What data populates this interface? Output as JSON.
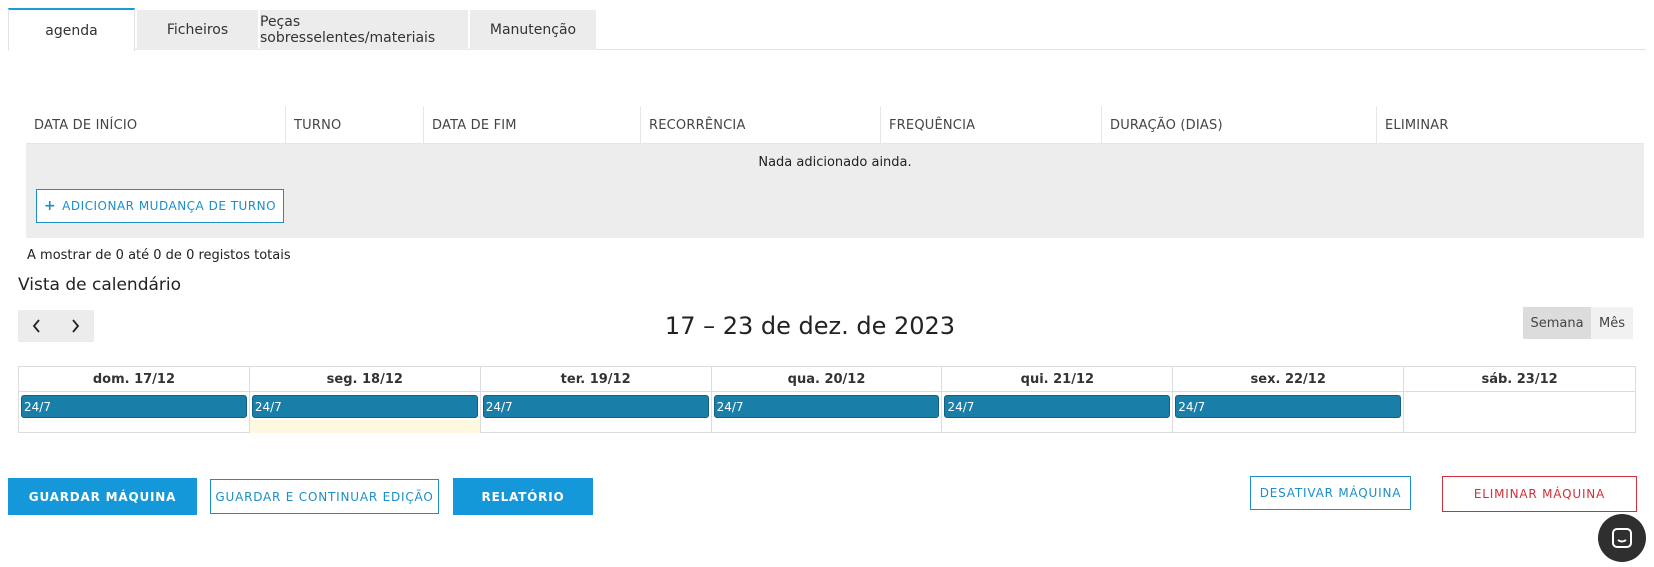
{
  "tabs": [
    {
      "label": "agenda",
      "active": true
    },
    {
      "label": "Ficheiros",
      "active": false
    },
    {
      "label": "Peças sobresselentes/materiais",
      "active": false
    },
    {
      "label": "Manutenção",
      "active": false
    }
  ],
  "table": {
    "columns": [
      "DATA DE INÍCIO",
      "TURNO",
      "DATA DE FIM",
      "RECORRÊNCIA",
      "FREQUÊNCIA",
      "DURAÇÃO (DIAS)",
      "ELIMINAR"
    ],
    "empty_text": "Nada adicionado ainda.",
    "add_button_label": "ADICIONAR MUDANÇA DE TURNO",
    "records_text": "A mostrar de 0 até 0 de 0 registos totais"
  },
  "calendar": {
    "title": "Vista de calendário",
    "range": "17 – 23 de dez. de 2023",
    "views": [
      "Semana",
      "Mês"
    ],
    "active_view": "Semana",
    "days": [
      {
        "label": "dom. 17/12",
        "event": "24/7"
      },
      {
        "label": "seg. 18/12",
        "event": "24/7"
      },
      {
        "label": "ter. 19/12",
        "event": "24/7"
      },
      {
        "label": "qua. 20/12",
        "event": "24/7"
      },
      {
        "label": "qui. 21/12",
        "event": "24/7"
      },
      {
        "label": "sex. 22/12",
        "event": "24/7"
      },
      {
        "label": "sáb. 23/12",
        "event": null
      }
    ]
  },
  "actions": {
    "save": "GUARDAR MÁQUINA",
    "save_continue": "GUARDAR E CONTINUAR EDIÇÃO",
    "report": "RELATÓRIO",
    "disable": "DESATIVAR MÁQUINA",
    "delete": "ELIMINAR MÁQUINA"
  },
  "colors": {
    "accent": "#1498da",
    "event": "#1a7fa8",
    "danger": "#d0303c",
    "today_highlight": "#fff8e1"
  },
  "icons": {
    "prev": "chevron-left-icon",
    "next": "chevron-right-icon",
    "add": "plus-icon",
    "chat": "chat-icon"
  }
}
